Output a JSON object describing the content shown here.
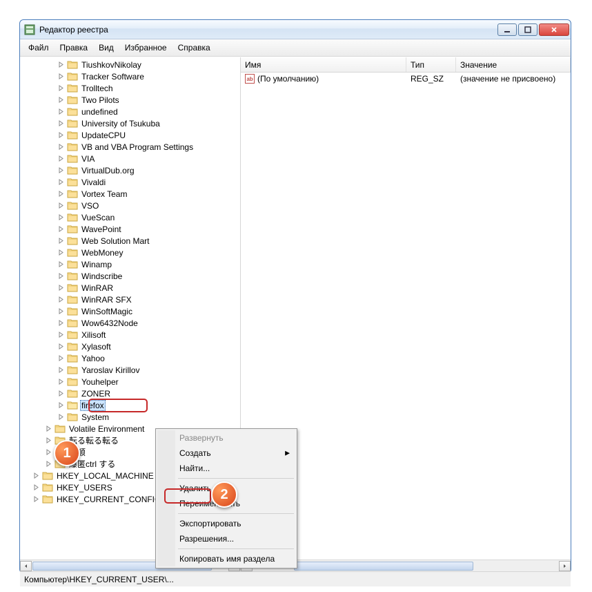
{
  "window": {
    "title": "Редактор реестра"
  },
  "menu": {
    "file": "Файл",
    "edit": "Правка",
    "view": "Вид",
    "favorites": "Избранное",
    "help": "Справка"
  },
  "tree": {
    "items": [
      "TiushkovNikolay",
      "Tracker Software",
      "Trolltech",
      "Two Pilots",
      "undefined",
      "University of Tsukuba",
      "UpdateCPU",
      "VB and VBA Program Settings",
      "VIA",
      "VirtualDub.org",
      "Vivaldi",
      "Vortex Team",
      "VSO",
      "VueScan",
      "WavePoint",
      "Web Solution Mart",
      "WebMoney",
      "Winamp",
      "Windscribe",
      "WinRAR",
      "WinRAR SFX",
      "WinSoftMagic",
      "Wow6432Node",
      "Xilisoft",
      "Xylasoft",
      "Yahoo",
      "Yaroslav Kirillov",
      "Youhelper",
      "ZONER"
    ],
    "selected": "firefox",
    "after_selected": "System",
    "siblings": [
      "Volatile Environment",
      "転る転る転る",
      "简顺",
      "爆匿ctrl する"
    ],
    "hives": [
      "HKEY_LOCAL_MACHINE",
      "HKEY_USERS",
      "HKEY_CURRENT_CONFIG"
    ]
  },
  "list": {
    "headers": {
      "name": "Имя",
      "type": "Тип",
      "value": "Значение"
    },
    "rows": [
      {
        "icon": "ab",
        "name": "(По умолчанию)",
        "type": "REG_SZ",
        "value": "(значение не присвоено)"
      }
    ]
  },
  "context_menu": {
    "expand": "Развернуть",
    "create": "Создать",
    "find": "Найти...",
    "delete": "Удалить",
    "rename": "Переименовать",
    "export": "Экспортировать",
    "permissions": "Разрешения...",
    "copy_key_name": "Копировать имя раздела"
  },
  "status": {
    "path": "Компьютер\\HKEY_CURRENT_USER\\..."
  },
  "callouts": {
    "one": "1",
    "two": "2"
  },
  "colors": {
    "accent": "#cce5ff",
    "callout": "#d8441a",
    "highlight": "#c62828"
  }
}
